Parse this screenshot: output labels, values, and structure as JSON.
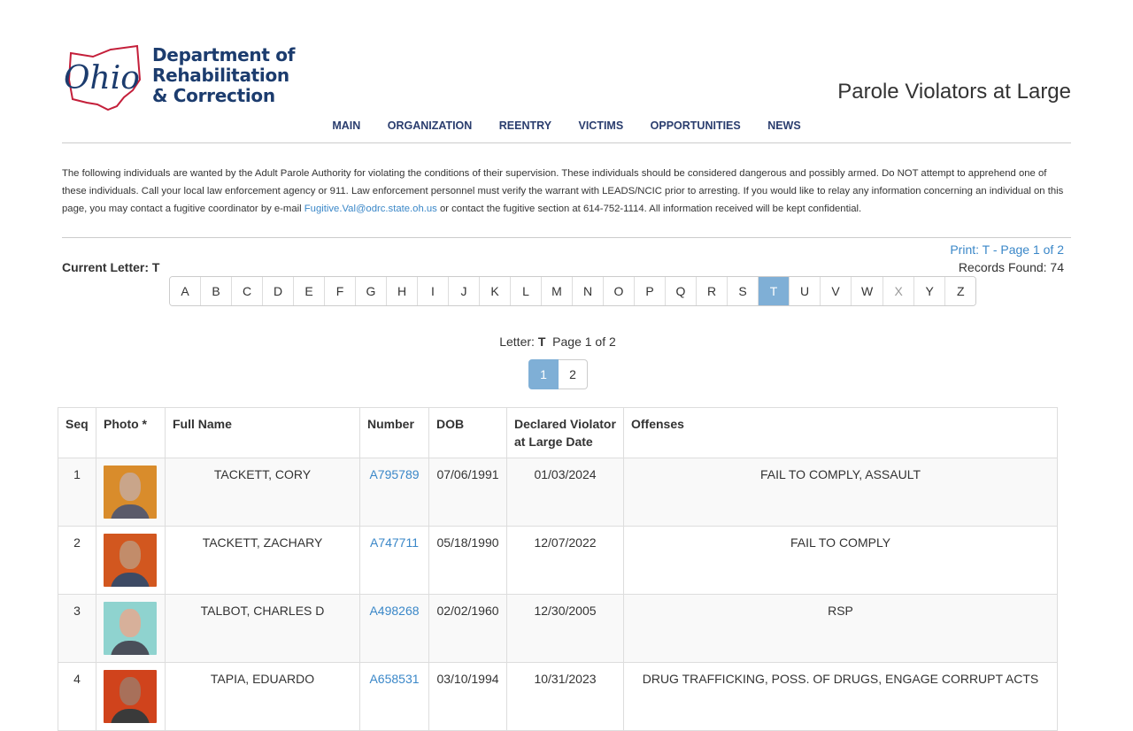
{
  "logo": {
    "script": "Ohio",
    "line1": "Department of",
    "line2": "Rehabilitation",
    "line3": "& Correction"
  },
  "page_title": "Parole Violators at Large",
  "nav": [
    "MAIN",
    "ORGANIZATION",
    "REENTRY",
    "VICTIMS",
    "OPPORTUNITIES",
    "NEWS"
  ],
  "intro": {
    "text_before": "The following individuals are wanted by the Adult Parole Authority for violating the conditions of their supervision.  These individuals should be considered dangerous and possibly armed.  Do NOT attempt to apprehend one of these individuals.  Call your local law enforcement agency or 911.  Law enforcement personnel must verify the warrant with LEADS/NCIC prior to arresting.  If you would like to relay any information concerning an individual on this page, you may contact a fugitive coordinator by e-mail ",
    "email": "Fugitive.Val@odrc.state.oh.us",
    "text_after": " or contact the fugitive section at 614-752-1114.  All information received will be kept confidential."
  },
  "print_link": "Print: T - Page 1 of 2",
  "records_found": "Records Found: 74",
  "current_letter": "Current Letter: T",
  "alphabet": [
    "A",
    "B",
    "C",
    "D",
    "E",
    "F",
    "G",
    "H",
    "I",
    "J",
    "K",
    "L",
    "M",
    "N",
    "O",
    "P",
    "Q",
    "R",
    "S",
    "T",
    "U",
    "V",
    "W",
    "X",
    "Y",
    "Z"
  ],
  "active_letter": "T",
  "disabled_letters": [
    "X"
  ],
  "letter_line": {
    "prefix": "Letter: ",
    "letter": "T",
    "suffix": "  Page 1 of 2"
  },
  "pager": {
    "current": "1",
    "next": "2"
  },
  "table": {
    "headers": [
      "Seq",
      "Photo *",
      "Full Name",
      "Number",
      "DOB",
      "Declared Violator at Large Date",
      "Offenses"
    ],
    "rows": [
      {
        "seq": "1",
        "name": "TACKETT, CORY",
        "number": "A795789",
        "dob": "07/06/1991",
        "declared": "01/03/2024",
        "offenses": "FAIL TO COMPLY, ASSAULT"
      },
      {
        "seq": "2",
        "name": "TACKETT, ZACHARY",
        "number": "A747711",
        "dob": "05/18/1990",
        "declared": "12/07/2022",
        "offenses": "FAIL TO COMPLY"
      },
      {
        "seq": "3",
        "name": "TALBOT, CHARLES D",
        "number": "A498268",
        "dob": "02/02/1960",
        "declared": "12/30/2005",
        "offenses": "RSP"
      },
      {
        "seq": "4",
        "name": "TAPIA, EDUARDO",
        "number": "A658531",
        "dob": "03/10/1994",
        "declared": "10/31/2023",
        "offenses": "DRUG TRAFFICKING, POSS. OF DRUGS, ENGAGE CORRUPT ACTS"
      }
    ]
  },
  "colors": {
    "brand_navy": "#1c3c6e",
    "brand_red": "#c41f3a",
    "link": "#3a87c8",
    "active": "#7fafd6"
  },
  "photos": [
    {
      "bg": "#d98c2b",
      "face": "#c9a58a",
      "body": "#5a5a6a"
    },
    {
      "bg": "#d2571f",
      "face": "#c28c6a",
      "body": "#3d4a64"
    },
    {
      "bg": "#8fd3cf",
      "face": "#d7b09a",
      "body": "#4a4f5a"
    },
    {
      "bg": "#d0431c",
      "face": "#a8705a",
      "body": "#3a3a3a"
    }
  ]
}
